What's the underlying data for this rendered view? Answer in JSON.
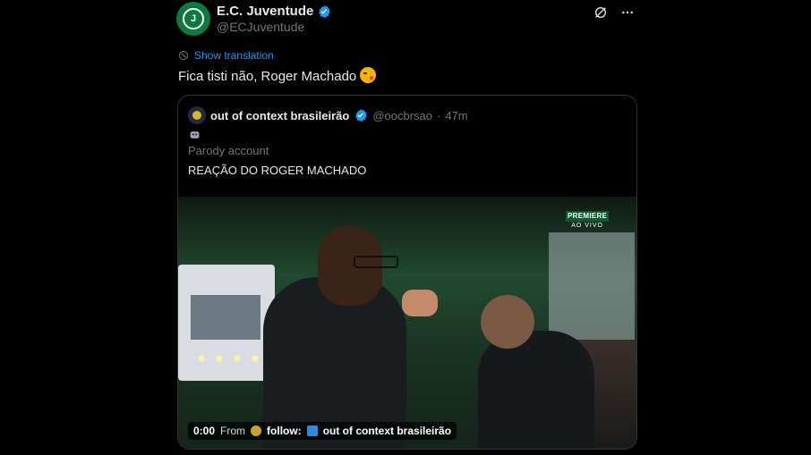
{
  "post": {
    "author_name": "E.C. Juventude",
    "author_handle": "@ECJuventude",
    "avatar_letter": "J",
    "verified": true,
    "actions": {
      "grok_icon": "grok-icon",
      "more_icon": "ellipsis-icon"
    },
    "translate_label": "Show translation",
    "text": "Fica tisti não, Roger Machado",
    "text_emoji": "kiss-face-emoji"
  },
  "quote": {
    "author_name": "out of context brasileirão",
    "author_handle": "@oocbrsao",
    "separator": "·",
    "time": "47m",
    "parody_label": "Parody account",
    "text": "REAÇÃO DO ROGER MACHADO",
    "video": {
      "broadcaster": "PREMIERE",
      "live_label": "AO VIVO",
      "time": "0:00",
      "from_label": "From",
      "follow_label": "follow:",
      "channel_name": "out of context brasileirão"
    }
  },
  "colors": {
    "background": "#000000",
    "link": "#1d9bf0",
    "secondary_text": "#71767b",
    "verified": "#1d9bf0"
  }
}
